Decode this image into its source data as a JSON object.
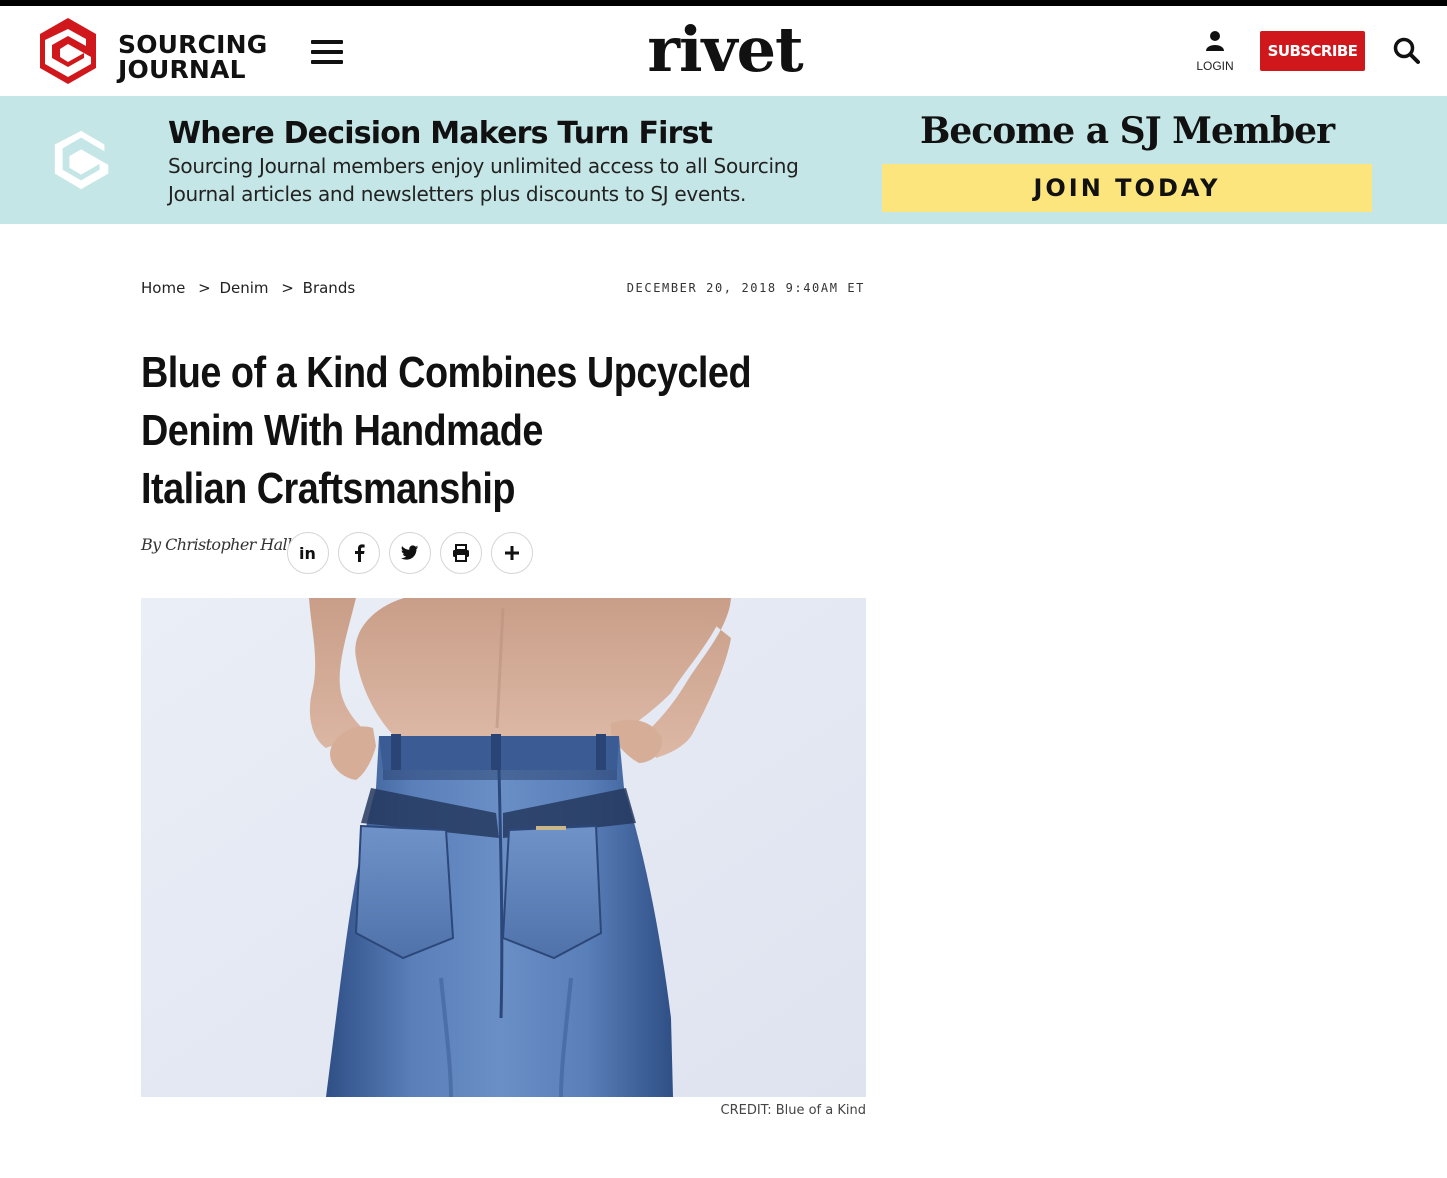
{
  "brand": {
    "line1": "SOURCING",
    "line2": "JOURNAL",
    "accent_color": "#d0171c"
  },
  "header": {
    "center_title": "rivet",
    "login_label": "LOGIN",
    "subscribe_label": "SUBSCRIBE",
    "icons": [
      "menu-icon",
      "user-icon",
      "search-icon"
    ]
  },
  "banner": {
    "title": "Where Decision Makers Turn First",
    "description": "Sourcing Journal members enjoy unlimited access to all Sourcing Journal articles and newsletters plus discounts to SJ events.",
    "cta_heading": "Become a SJ Member",
    "cta_button": "JOIN TODAY",
    "background_color": "#c5e6e6",
    "button_color": "#fbe57c"
  },
  "article": {
    "breadcrumb": [
      "Home",
      "Denim",
      "Brands"
    ],
    "date": "DECEMBER 20, 2018 9:40AM ET",
    "headline_lines": [
      "Blue of a Kind Combines Upcycled",
      "Denim With Handmade",
      "Italian Craftsmanship"
    ],
    "byline": "By Christopher Hall",
    "share_icons": [
      "linkedin-icon",
      "facebook-icon",
      "twitter-icon",
      "print-icon",
      "plus-icon"
    ],
    "image_credit": "CREDIT: Blue of a Kind"
  }
}
